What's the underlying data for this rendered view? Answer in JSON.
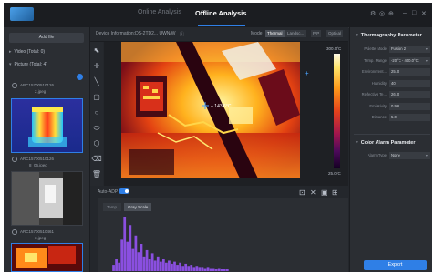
{
  "header": {
    "tabs": [
      {
        "label": "Online Analysis",
        "active": false
      },
      {
        "label": "Offline Analysis",
        "active": true
      }
    ],
    "window_controls": [
      "⚙",
      "◎",
      "⊕",
      "–",
      "□",
      "✕"
    ]
  },
  "left_panel": {
    "add_file_label": "Add file",
    "video_group": "Video (Total: 0)",
    "picture_group": "Picture (Total: 4)",
    "files": [
      {
        "name": "ARC1570",
        "suffix": "0510126",
        "sub": "2.jpeg"
      },
      {
        "name": "ARC1570",
        "suffix": "0510126",
        "sub": "8_06.jpeg"
      },
      {
        "name": "ARC1570",
        "suffix": "0510461",
        "sub": "3.jpeg"
      }
    ]
  },
  "toolbar": {
    "device_info": "Device Information:DS-2TD2... UWN/W",
    "mode_label": "Mode",
    "modes": [
      {
        "label": "Thermal",
        "active": true
      },
      {
        "label": "Landsc...",
        "active": false
      },
      {
        "label": "PIP",
        "active": false
      },
      {
        "label": "Optical",
        "active": false
      }
    ]
  },
  "tools": [
    "cursor-icon",
    "crosshair-icon",
    "line-icon",
    "rectangle-icon",
    "circle-icon",
    "ellipse-icon",
    "polygon-icon",
    "clear-icon",
    "delete-icon"
  ],
  "image": {
    "colorbar_top": "300.0°C",
    "colorbar_bottom": "25.0°C",
    "marker_label": "+ 143.6°C"
  },
  "auto_adj_label": "Auto-ADP",
  "histogram": {
    "tabs": [
      {
        "label": "Temp.",
        "active": false
      },
      {
        "label": "Gray Scale",
        "active": true
      }
    ],
    "bins": [
      0,
      0,
      0,
      0,
      6,
      12,
      8,
      30,
      52,
      28,
      44,
      22,
      34,
      18,
      26,
      14,
      20,
      12,
      17,
      10,
      14,
      9,
      12,
      8,
      10,
      7,
      9,
      6,
      8,
      5,
      7,
      5,
      6,
      4,
      5,
      4,
      4,
      3,
      4,
      3,
      3,
      2,
      3,
      2,
      2,
      2
    ]
  },
  "right_panel": {
    "thermo_title": "Thermography Parameter",
    "params": [
      {
        "label": "Palette Mode",
        "value": "Fusion 2",
        "dropdown": true
      },
      {
        "label": "Temp. Range",
        "value": "-20°C - 400.0°C",
        "dropdown": true
      },
      {
        "label": "Environment...",
        "value": "25.0",
        "dropdown": false
      },
      {
        "label": "Humidity",
        "value": "40",
        "dropdown": false
      },
      {
        "label": "Reflective Te...",
        "value": "26.0",
        "dropdown": false
      },
      {
        "label": "Emissivity",
        "value": "0.96",
        "dropdown": false
      },
      {
        "label": "Distance",
        "value": "5.0",
        "dropdown": false
      }
    ],
    "alarm_title": "Color Alarm Parameter",
    "alarm_label": "Alarm Type",
    "alarm_value": "None",
    "export_label": "Export"
  },
  "colors": {
    "accent": "#2f7fe6",
    "histogram_bar": "#8a4fe0",
    "bg": "#24272c"
  }
}
